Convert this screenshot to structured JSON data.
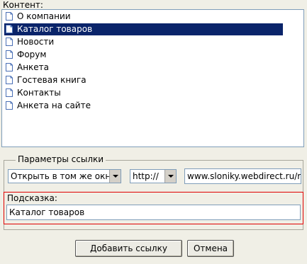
{
  "content_label": "Контент:",
  "pages": [
    {
      "label": "О компании",
      "selected": false
    },
    {
      "label": "Каталог товаров",
      "selected": true
    },
    {
      "label": "Новости",
      "selected": false
    },
    {
      "label": "Форум",
      "selected": false
    },
    {
      "label": "Анкета",
      "selected": false
    },
    {
      "label": "Гостевая книга",
      "selected": false
    },
    {
      "label": "Контакты",
      "selected": false
    },
    {
      "label": "Анкета на сайте",
      "selected": false
    }
  ],
  "link_params": {
    "legend": "Параметры ссылки",
    "target_select": "Открыть в том же окне",
    "protocol_select": "http://",
    "url_value": "www.sloniky.webdirect.ru/ru"
  },
  "hint": {
    "label": "Подсказка:",
    "value": "Каталог товаров"
  },
  "buttons": {
    "add_link": "Добавить ссылку",
    "cancel": "Отмена"
  }
}
